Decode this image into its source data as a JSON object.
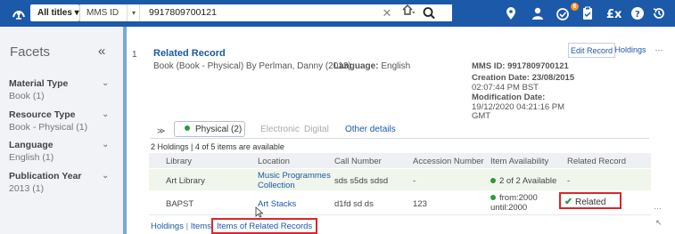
{
  "topbar": {
    "scope_label": "All titles ▾",
    "field_label": "MMS ID",
    "field_caret": "▾",
    "search_value": "9917809700121",
    "clear_glyph": "✕",
    "notification_count": "6",
    "accent_color": "#1c59a8"
  },
  "facets": {
    "title": "Facets",
    "collapse_glyph": "«",
    "groups": [
      {
        "title": "Material Type",
        "value": "Book (1)"
      },
      {
        "title": "Resource Type",
        "value": "Book - Physical (1)"
      },
      {
        "title": "Language",
        "value": "English (1)"
      },
      {
        "title": "Publication Year",
        "value": "2013 (1)"
      }
    ]
  },
  "record": {
    "row_number": "1",
    "title": "Related Record",
    "subtitle": "Book (Book - Physical) By Perlman, Danny (2013)",
    "language_label": "Language:",
    "language_value": "English",
    "mms_id": "MMS ID: 9917809700121",
    "creation_label": "Creation Date: 23/08/2015",
    "creation_time": "02:07:44 PM BST",
    "modification_label": "Modification Date:",
    "modification_value": "19/12/2020 04:21:16 PM",
    "modification_tz": "GMT",
    "actions": {
      "edit": "Edit Record",
      "holdings": "Holdings",
      "more": "···"
    }
  },
  "tabs": {
    "expand_glyph": "≫",
    "physical": "Physical (2)",
    "electronic": "Electronic",
    "digital": "Digital",
    "other": "Other details"
  },
  "holdings": {
    "summary": "2 Holdings | 4 of 5 items are available",
    "headers": [
      "Library",
      "Location",
      "Call Number",
      "Accession Number",
      "Item Availability",
      "Related Record"
    ],
    "rows": [
      {
        "library": "Art Library",
        "location_1": "Music Programmes",
        "location_2": "Collection",
        "call_number": "sds s5ds sdsd",
        "accession": "-",
        "availability": "2 of 2 Available",
        "related": "-"
      },
      {
        "library": "BAPST",
        "location": "Art Stacks",
        "call_number": "d1fd sd ds",
        "accession": "123",
        "availability_1": "from:2000",
        "availability_2": "until:2000",
        "related": "Related"
      }
    ]
  },
  "footer_links": {
    "holdings": "Holdings",
    "sep": "|",
    "items": "Items",
    "related_records": "Items of Related Records"
  },
  "side": {
    "more": "···",
    "resize": "↖"
  }
}
